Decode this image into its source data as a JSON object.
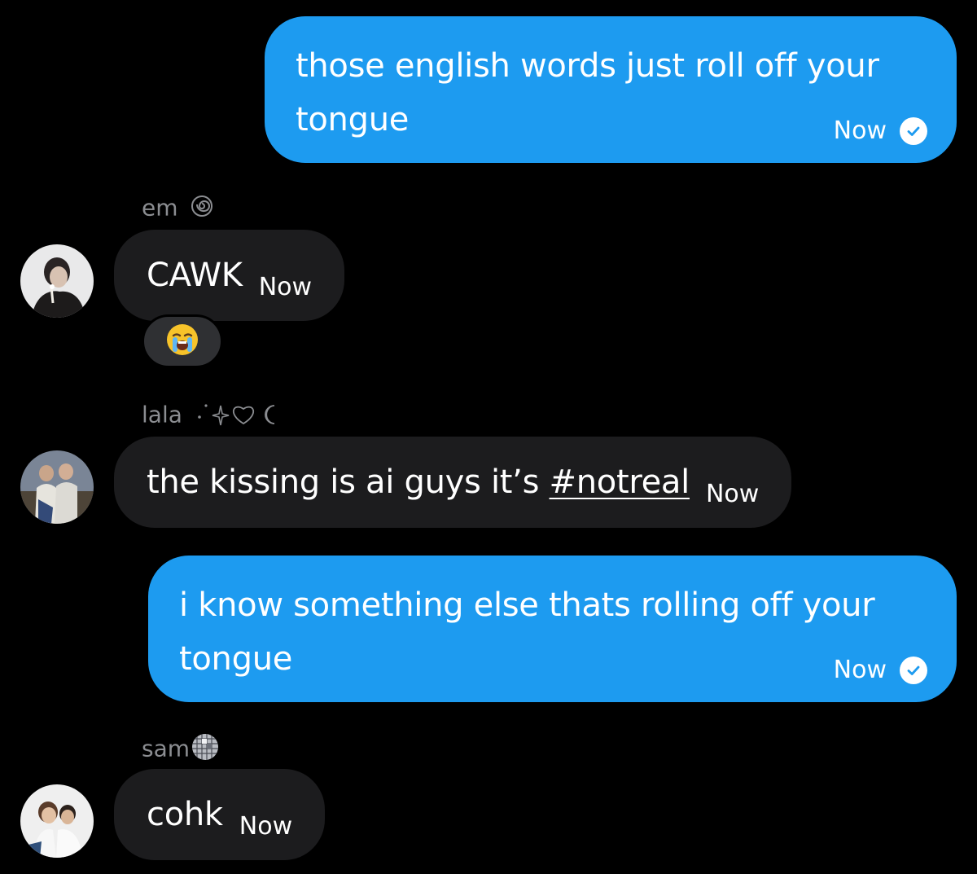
{
  "messages": {
    "m1": {
      "text": "those english words just roll off your tongue",
      "time": "Now"
    },
    "m2": {
      "sender": "em",
      "text": "CAWK",
      "time": "Now"
    },
    "m3": {
      "sender": "lala",
      "text_prefix": "the kissing is ai guys it’s ",
      "hashtag": "#notreal",
      "time": "Now"
    },
    "m4": {
      "text": "i know something else thats rolling off your tongue",
      "time": "Now"
    },
    "m5": {
      "sender": "sam",
      "text": "cohk",
      "time": "Now"
    }
  },
  "icons": {
    "sent": "check-circle-icon",
    "em_decoration": "spiral-icon",
    "lala_decoration": "sparkle-heart-moon-icon",
    "sam_decoration": "disco-ball-icon",
    "reaction": "loudly-crying-face-icon"
  },
  "colors": {
    "background": "#000000",
    "outgoing_bubble": "#1d9bf0",
    "incoming_bubble": "#1c1c1e",
    "sender_name": "#8b8d91"
  }
}
